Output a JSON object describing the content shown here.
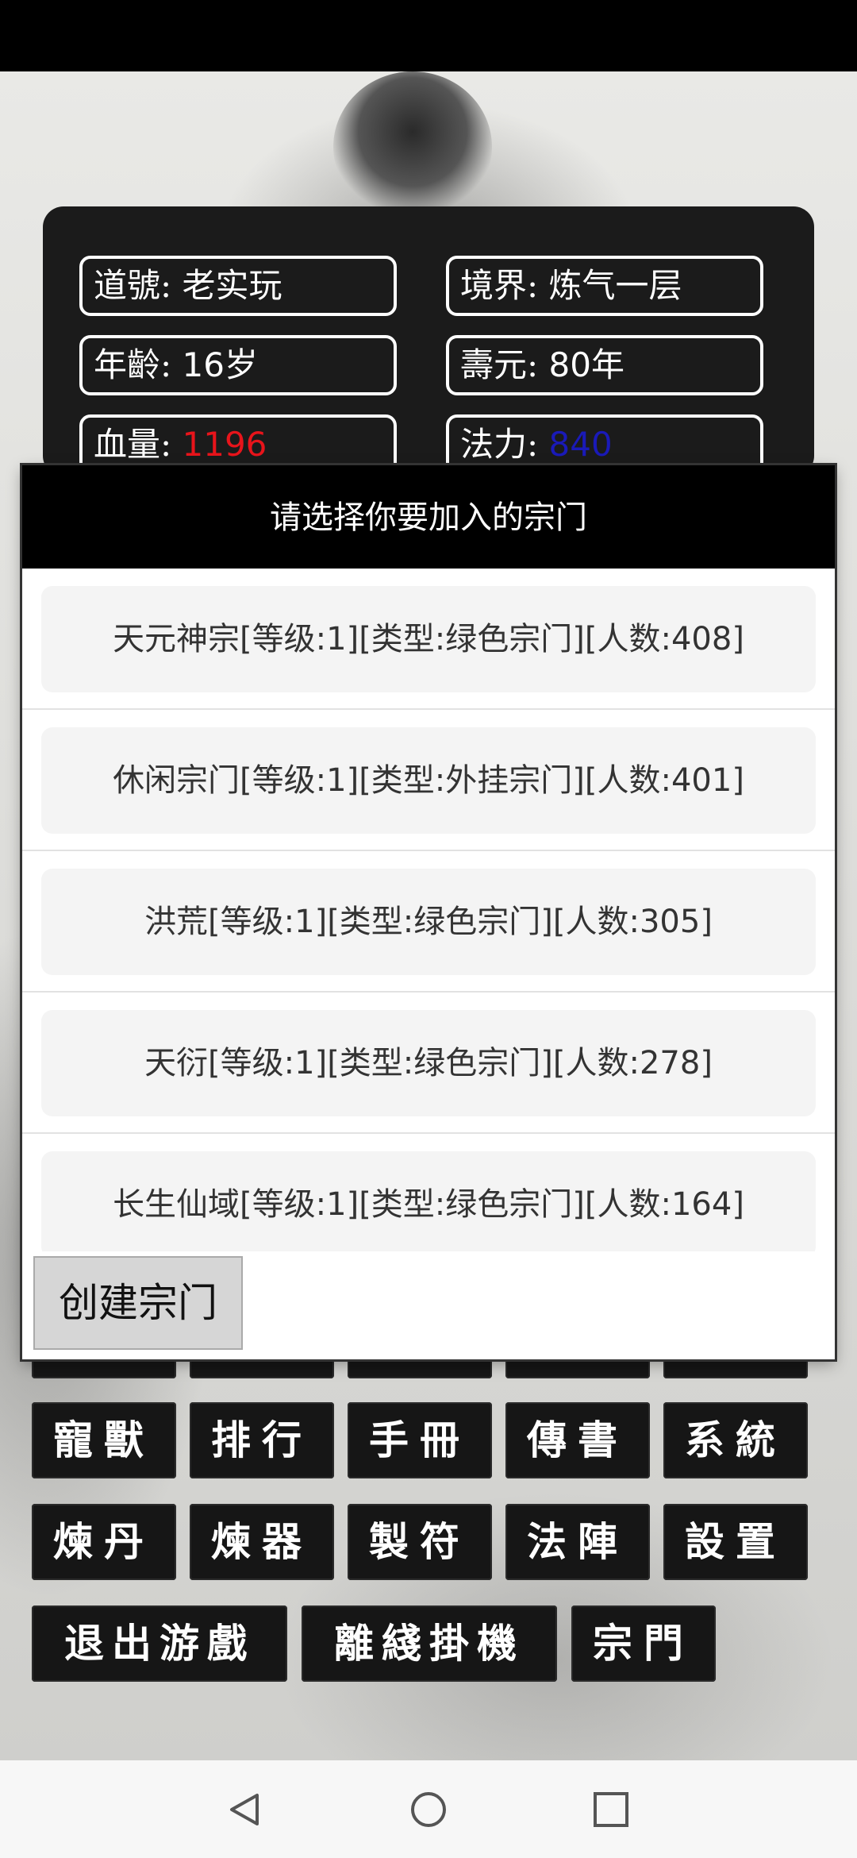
{
  "player": {
    "name_label": "道號:",
    "name_value": "老实玩",
    "realm_label": "境界:",
    "realm_value": "炼气一层",
    "age_label": "年齡:",
    "age_value": "16岁",
    "lifespan_label": "壽元:",
    "lifespan_value": "80年",
    "hp_label": "血量:",
    "hp_value": "1196",
    "mana_label": "法力:",
    "mana_value": "840",
    "hp_color": "#e8141b",
    "mana_color": "#1a1ab8"
  },
  "menu": {
    "row2": [
      "寵獸",
      "排行",
      "手冊",
      "傳書",
      "系統"
    ],
    "row3": [
      "煉丹",
      "煉器",
      "製符",
      "法陣",
      "設置"
    ],
    "row4": [
      "退出游戲",
      "離綫掛機",
      "宗門"
    ]
  },
  "dialog": {
    "title": "请选择你要加入的宗门",
    "sects": [
      "天元神宗[等级:1][类型:绿色宗门][人数:408]",
      "休闲宗门[等级:1][类型:外挂宗门][人数:401]",
      "洪荒[等级:1][类型:绿色宗门][人数:305]",
      "天衍[等级:1][类型:绿色宗门][人数:278]",
      "长生仙域[等级:1][类型:绿色宗门][人数:164]"
    ],
    "create_label": "创建宗门"
  },
  "navbar": {
    "icons": [
      "back-icon",
      "home-icon",
      "recents-icon"
    ]
  }
}
